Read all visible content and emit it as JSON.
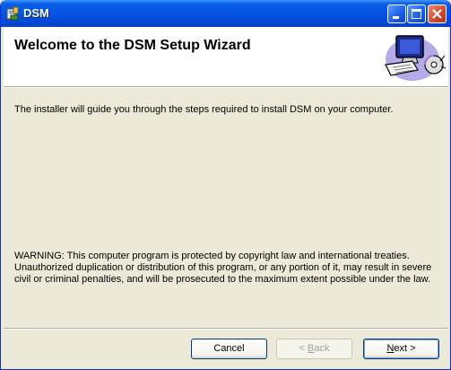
{
  "window": {
    "title": "DSM",
    "controls": {
      "minimize": "minimize",
      "maximize": "maximize",
      "close": "close"
    }
  },
  "header": {
    "title": "Welcome to the DSM Setup Wizard",
    "graphic": "computer-with-disc-icon"
  },
  "body": {
    "intro": "The installer will guide you through the steps required to install DSM on your computer.",
    "warning": "WARNING: This computer program is protected by copyright law and international treaties. Unauthorized duplication or distribution of this program, or any portion of it, may result in severe civil or criminal penalties, and will be prosecuted to the maximum extent possible under the law."
  },
  "buttons": {
    "cancel": "Cancel",
    "back_prefix": "< ",
    "back_hotkey": "B",
    "back_rest": "ack",
    "next_hotkey": "N",
    "next_rest": "ext >"
  },
  "colors": {
    "titlebar": "#0353e0",
    "dialog_bg": "#ece9d8",
    "header_bg": "#ffffff"
  }
}
